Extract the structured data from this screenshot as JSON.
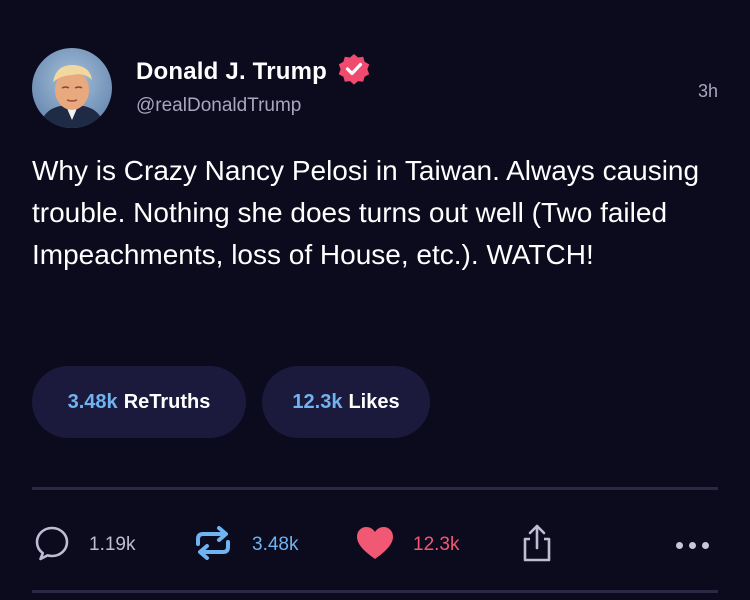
{
  "author": {
    "name": "Donald J. Trump",
    "handle": "@realDonaldTrump",
    "verified_icon": "verified-badge-icon",
    "avatar": "profile-photo"
  },
  "post": {
    "time": "3h",
    "text": "Why is Crazy Nancy Pelosi in Taiwan. Always causing trouble. Nothing she does turns out well (Two failed Impeachments, loss of House, etc.). WATCH!"
  },
  "stats": {
    "retruths_count": "3.48k",
    "retruths_label": "ReTruths",
    "likes_count": "12.3k",
    "likes_label": "Likes"
  },
  "actions": {
    "reply_count": "1.19k",
    "retruth_count": "3.48k",
    "like_count": "12.3k",
    "icons": [
      "reply-bubble-icon",
      "retruth-arrows-icon",
      "heart-icon",
      "share-icon",
      "more-dots-icon"
    ]
  },
  "colors": {
    "background": "#0c0a1d",
    "accent_blue": "#6fb3f0",
    "like_pink": "#f05873",
    "verified_pink": "#f04a6e",
    "pill_bg": "#1b1a3d"
  }
}
